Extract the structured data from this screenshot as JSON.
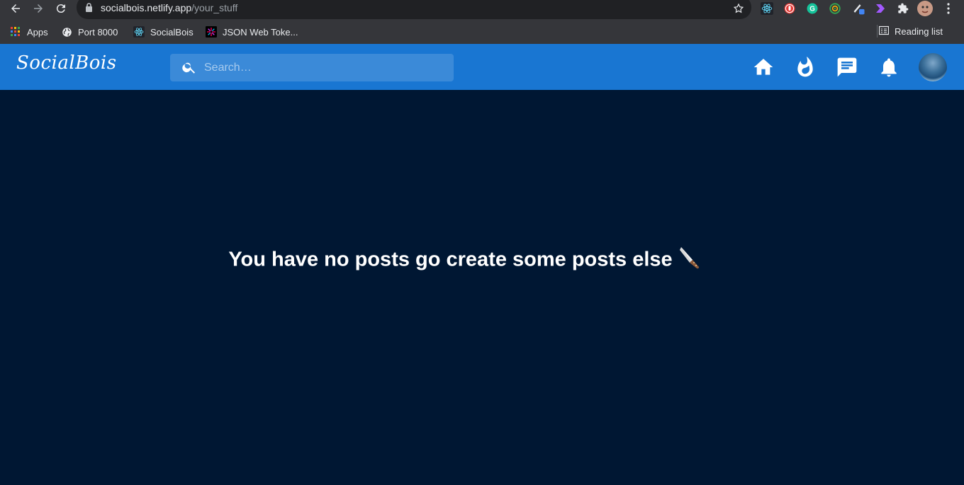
{
  "browser": {
    "url_host": "socialbois.netlify.app",
    "url_path": "/your_stuff",
    "bookmarks": [
      {
        "label": "Apps",
        "icon": "apps-grid-icon"
      },
      {
        "label": "Port 8000",
        "icon": "globe-icon"
      },
      {
        "label": "SocialBois",
        "icon": "react-icon"
      },
      {
        "label": "JSON Web Toke...",
        "icon": "jwt-icon"
      }
    ],
    "reading_list": "Reading list"
  },
  "app": {
    "brand": "SocialBois",
    "search_placeholder": "Search…",
    "nav_icons": [
      "home-icon",
      "whatshot-icon",
      "chat-icon",
      "notifications-icon"
    ],
    "accent": "#1976d2",
    "background": "#001733"
  },
  "main": {
    "message": "You have no posts go create some posts else"
  }
}
